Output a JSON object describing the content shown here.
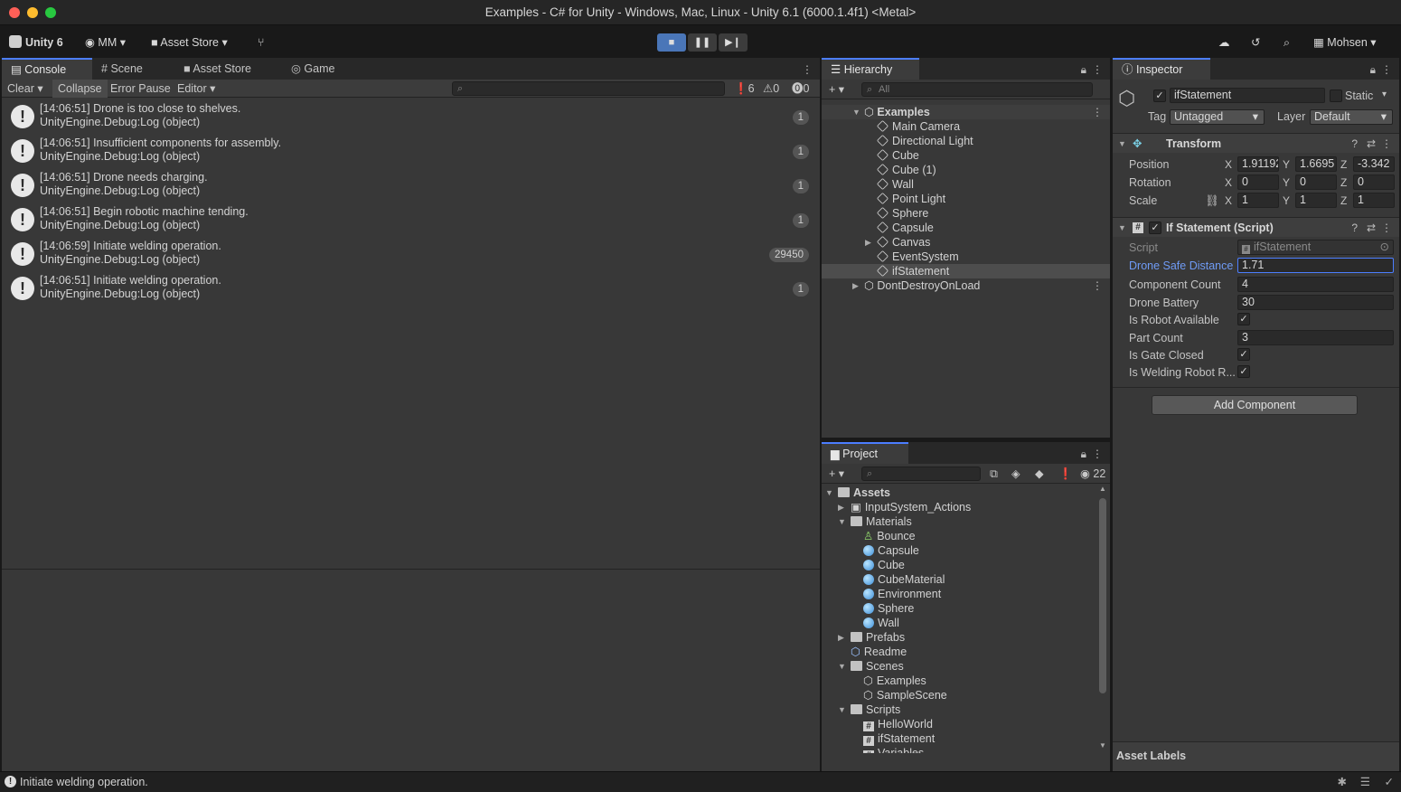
{
  "window": {
    "title": "Examples - C# for Unity - Windows, Mac, Linux - Unity 6.1 (6000.1.4f1) <Metal>"
  },
  "toolbar": {
    "unity_label": "Unity 6",
    "account_label": "MM",
    "asset_store_label": "Asset Store",
    "user_label": "Mohsen"
  },
  "console": {
    "tabs": [
      "Console",
      "Scene",
      "Asset Store",
      "Game"
    ],
    "clear_label": "Clear",
    "collapse_label": "Collapse",
    "error_pause_label": "Error Pause",
    "editor_label": "Editor",
    "info_count": "6",
    "warn_count": "0",
    "error_count": "0",
    "logs": [
      {
        "line1": "[14:06:51] Drone is too close to shelves.",
        "line2": "UnityEngine.Debug:Log (object)",
        "count": "1"
      },
      {
        "line1": "[14:06:51] Insufficient components for assembly.",
        "line2": "UnityEngine.Debug:Log (object)",
        "count": "1"
      },
      {
        "line1": "[14:06:51] Drone needs charging.",
        "line2": "UnityEngine.Debug:Log (object)",
        "count": "1"
      },
      {
        "line1": "[14:06:51] Begin robotic machine tending.",
        "line2": "UnityEngine.Debug:Log (object)",
        "count": "1"
      },
      {
        "line1": "[14:06:59] Initiate welding operation.",
        "line2": "UnityEngine.Debug:Log (object)",
        "count": "29450"
      },
      {
        "line1": "[14:06:51] Initiate welding operation.",
        "line2": "UnityEngine.Debug:Log (object)",
        "count": "1"
      }
    ]
  },
  "hierarchy": {
    "tab": "Hierarchy",
    "search_placeholder": "All",
    "scene": "Examples",
    "items": [
      "Main Camera",
      "Directional Light",
      "Cube",
      "Cube (1)",
      "Wall",
      "Point Light",
      "Sphere",
      "Capsule",
      "Canvas",
      "EventSystem",
      "ifStatement"
    ],
    "ddol": "DontDestroyOnLoad"
  },
  "project": {
    "tab": "Project",
    "hidden_count": "22",
    "assets": "Assets",
    "tree": [
      {
        "label": "InputSystem_Actions",
        "icon": "input-icon"
      },
      {
        "label": "Materials",
        "icon": "folder-icon"
      },
      {
        "label": "Bounce",
        "icon": "physics-material-icon"
      },
      {
        "label": "Capsule",
        "icon": "material-icon"
      },
      {
        "label": "Cube",
        "icon": "material-icon"
      },
      {
        "label": "CubeMaterial",
        "icon": "material-icon"
      },
      {
        "label": "Environment",
        "icon": "material-icon"
      },
      {
        "label": "Sphere",
        "icon": "material-icon"
      },
      {
        "label": "Wall",
        "icon": "material-icon"
      },
      {
        "label": "Prefabs",
        "icon": "folder-icon"
      },
      {
        "label": "Readme",
        "icon": "readme-icon"
      },
      {
        "label": "Scenes",
        "icon": "folder-icon"
      },
      {
        "label": "Examples",
        "icon": "scene-icon"
      },
      {
        "label": "SampleScene",
        "icon": "scene-icon"
      },
      {
        "label": "Scripts",
        "icon": "folder-icon"
      },
      {
        "label": "HelloWorld",
        "icon": "script-icon"
      },
      {
        "label": "ifStatement",
        "icon": "script-icon"
      },
      {
        "label": "Variables",
        "icon": "script-icon"
      }
    ]
  },
  "inspector": {
    "tab": "Inspector",
    "object_name": "ifStatement",
    "static_label": "Static",
    "tag_label": "Tag",
    "tag_value": "Untagged",
    "layer_label": "Layer",
    "layer_value": "Default",
    "transform": {
      "title": "Transform",
      "position_label": "Position",
      "rotation_label": "Rotation",
      "scale_label": "Scale",
      "position": [
        "1.91192",
        "1.6695",
        "-3.342"
      ],
      "rotation": [
        "0",
        "0",
        "0"
      ],
      "scale": [
        "1",
        "1",
        "1"
      ]
    },
    "script": {
      "title": "If Statement (Script)",
      "script_label": "Script",
      "script_value": "ifStatement",
      "fields": [
        {
          "label": "Drone Safe Distance",
          "value": "1.71"
        },
        {
          "label": "Component Count",
          "value": "4"
        },
        {
          "label": "Drone Battery",
          "value": "30"
        },
        {
          "label": "Is Robot Available",
          "value": "✓"
        },
        {
          "label": "Part Count",
          "value": "3"
        },
        {
          "label": "Is Gate Closed",
          "value": "✓"
        },
        {
          "label": "Is Welding Robot R...",
          "value": "✓"
        }
      ]
    },
    "add_component": "Add Component",
    "asset_labels": "Asset Labels"
  },
  "statusbar": {
    "message": "Initiate welding operation."
  },
  "colors": {
    "accent": "#4c7eff",
    "selected_row": "#4d4d4d",
    "link_label": "#6f9bf5"
  }
}
